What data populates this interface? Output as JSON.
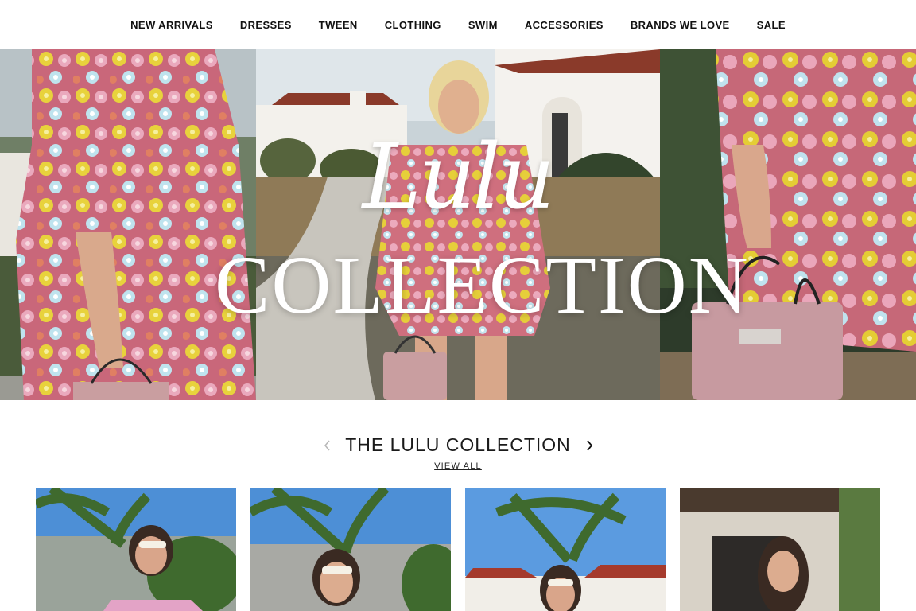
{
  "nav": {
    "items": [
      {
        "label": "NEW ARRIVALS"
      },
      {
        "label": "DRESSES"
      },
      {
        "label": "TWEEN"
      },
      {
        "label": "CLOTHING"
      },
      {
        "label": "SWIM"
      },
      {
        "label": "ACCESSORIES"
      },
      {
        "label": "BRANDS WE LOVE"
      },
      {
        "label": "SALE"
      }
    ]
  },
  "hero": {
    "script_word": "Lulu",
    "main_word": "COLLECTION"
  },
  "collection": {
    "title": "THE LULU COLLECTION",
    "view_all": "VIEW ALL",
    "prev_icon": "chevron-left-icon",
    "next_icon": "chevron-right-icon"
  },
  "colors": {
    "accent_text": "#1a1a1a",
    "dress_pink": "#d6788a",
    "dress_yellow": "#e6cf3a",
    "bag_pink": "#c99ea0",
    "sky_blue": "#5b9be0"
  }
}
